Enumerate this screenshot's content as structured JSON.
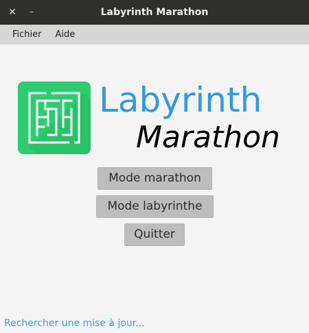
{
  "window": {
    "title": "Labyrinth Marathon",
    "close_glyph": "✕",
    "minimize_glyph": "–"
  },
  "menubar": {
    "items": [
      {
        "label": "Fichier"
      },
      {
        "label": "Aide"
      }
    ]
  },
  "logo": {
    "title": "Labyrinth",
    "subtitle": "Marathon",
    "icon": "maze-icon",
    "colors": {
      "tile": "#2ecc71",
      "title": "#3498db",
      "subtitle": "#000000"
    }
  },
  "buttons": {
    "marathon": "Mode marathon",
    "labyrinthe": "Mode labyrinthe",
    "quitter": "Quitter"
  },
  "update_link": "Rechercher une mise à jour..."
}
